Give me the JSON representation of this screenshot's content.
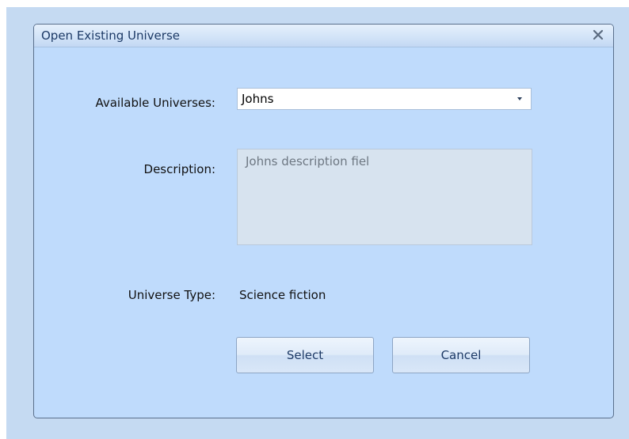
{
  "dialog": {
    "title": "Open Existing Universe",
    "close_icon": "close-icon"
  },
  "form": {
    "available_label": "Available Universes:",
    "available_value": "Johns",
    "description_label": "Description:",
    "description_value": "Johns description fiel",
    "type_label": "Universe Type:",
    "type_value": "Science fiction"
  },
  "buttons": {
    "select_label": "Select",
    "cancel_label": "Cancel"
  },
  "colors": {
    "backdrop": "#c5daf2",
    "dialog_background": "#bfdbfc",
    "title_text": "#1d3a66"
  }
}
